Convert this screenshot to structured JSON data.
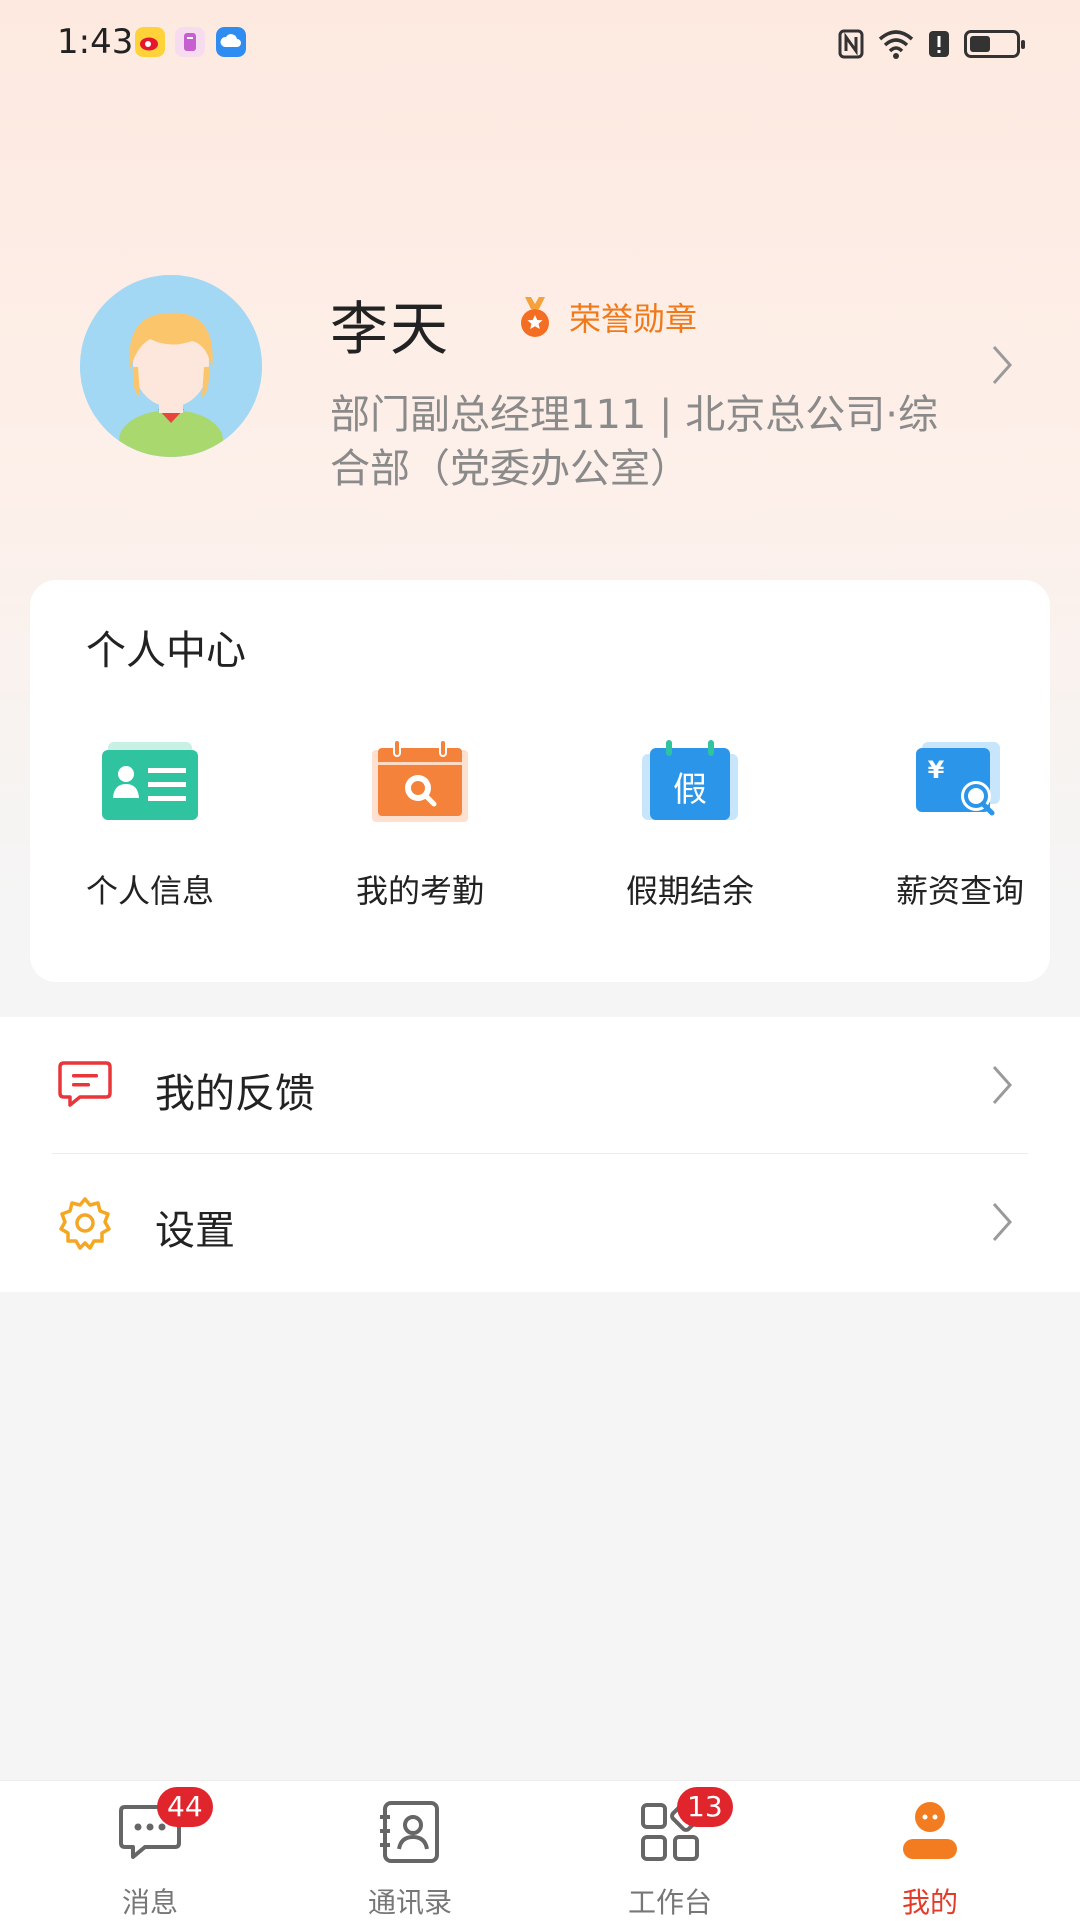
{
  "status_bar": {
    "time": "1:43",
    "battery_level": 0.45
  },
  "profile": {
    "name": "李天",
    "medal": "荣誉勋章",
    "department": "部门副总经理111 | 北京总公司·综合部（党委办公室）"
  },
  "personal_center": {
    "title": "个人中心",
    "items": [
      {
        "label": "个人信息",
        "icon": "id-card-icon"
      },
      {
        "label": "我的考勤",
        "icon": "attendance-calendar-icon"
      },
      {
        "label": "假期结余",
        "icon": "leave-calendar-icon",
        "glyph": "假"
      },
      {
        "label": "薪资查询",
        "icon": "salary-search-icon",
        "glyph": "¥"
      }
    ]
  },
  "menu": [
    {
      "label": "我的反馈",
      "icon": "feedback-icon"
    },
    {
      "label": "设置",
      "icon": "settings-gear-icon"
    }
  ],
  "tabs": [
    {
      "label": "消息",
      "badge": "44"
    },
    {
      "label": "通讯录",
      "badge": ""
    },
    {
      "label": "工作台",
      "badge": "13"
    },
    {
      "label": "我的",
      "badge": "",
      "active": true
    }
  ],
  "colors": {
    "accent_red": "#e23b2a",
    "medal_orange": "#f07a1a",
    "badge_red": "#e0262c",
    "id_green": "#2fc3a0",
    "attendance_orange": "#f4823a",
    "leave_blue": "#2b95ea"
  }
}
